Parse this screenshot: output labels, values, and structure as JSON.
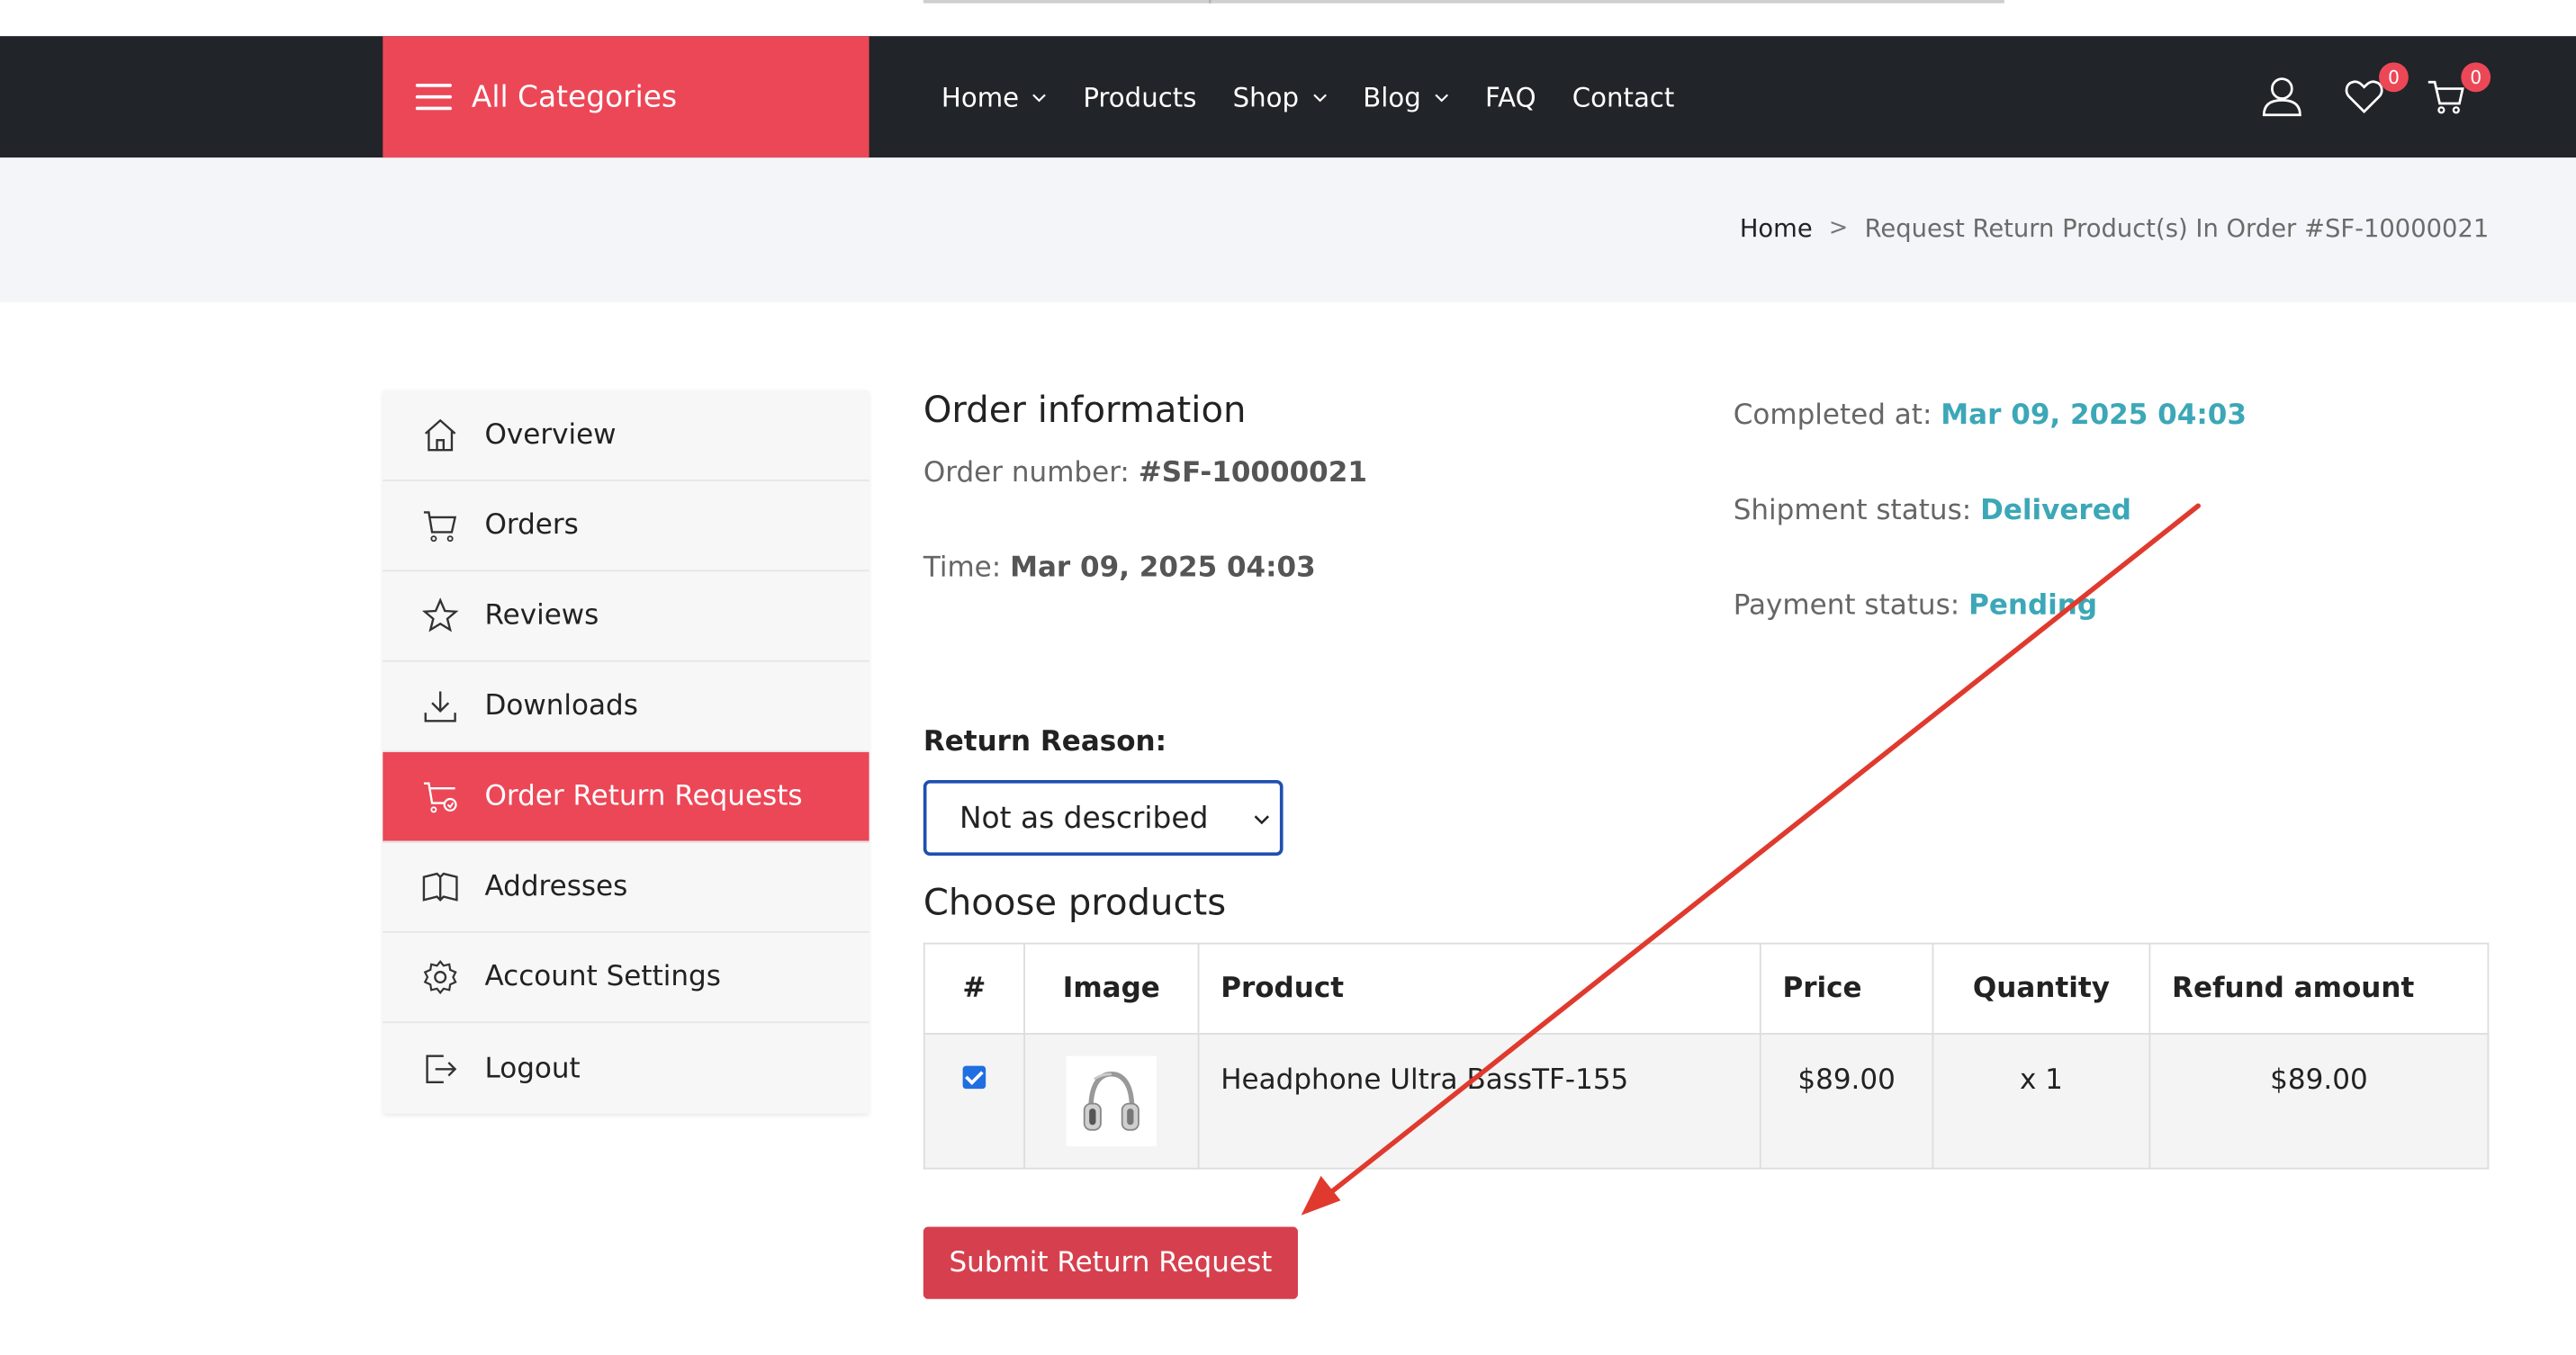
{
  "nav": {
    "all_categories": "All Categories",
    "menu": [
      {
        "label": "Home",
        "has_dropdown": true
      },
      {
        "label": "Products",
        "has_dropdown": false
      },
      {
        "label": "Shop",
        "has_dropdown": true
      },
      {
        "label": "Blog",
        "has_dropdown": true
      },
      {
        "label": "FAQ",
        "has_dropdown": false
      },
      {
        "label": "Contact",
        "has_dropdown": false
      }
    ],
    "wishlist_count": "0",
    "cart_count": "0"
  },
  "breadcrumb": {
    "home": "Home",
    "separator": ">",
    "current": "Request Return Product(s) In Order #SF-10000021"
  },
  "sidebar": {
    "items": [
      {
        "label": "Overview",
        "icon": "home-icon"
      },
      {
        "label": "Orders",
        "icon": "cart-icon"
      },
      {
        "label": "Reviews",
        "icon": "star-icon"
      },
      {
        "label": "Downloads",
        "icon": "download-icon"
      },
      {
        "label": "Order Return Requests",
        "icon": "cart-return-icon",
        "active": true
      },
      {
        "label": "Addresses",
        "icon": "book-icon"
      },
      {
        "label": "Account Settings",
        "icon": "gear-icon"
      },
      {
        "label": "Logout",
        "icon": "logout-icon"
      }
    ]
  },
  "order": {
    "title": "Order information",
    "number_label": "Order number:",
    "number_value": "#SF-10000021",
    "time_label": "Time:",
    "time_value": "Mar 09, 2025 04:03",
    "completed_label": "Completed at:",
    "completed_value": "Mar 09, 2025 04:03",
    "shipment_label": "Shipment status:",
    "shipment_value": "Delivered",
    "payment_label": "Payment status:",
    "payment_value": "Pending"
  },
  "return_form": {
    "reason_label": "Return Reason:",
    "reason_selected": "Not as described",
    "choose_title": "Choose products",
    "columns": [
      "#",
      "Image",
      "Product",
      "Price",
      "Quantity",
      "Refund amount"
    ],
    "rows": [
      {
        "checked": true,
        "product": "Headphone Ultra BassTF-155",
        "price": "$89.00",
        "quantity": "x 1",
        "refund": "$89.00"
      }
    ],
    "submit_label": "Submit Return Request"
  },
  "colors": {
    "accent_red": "#ec4757",
    "navbar_dark": "#212428",
    "status_teal": "#3ca7b7",
    "select_border": "#1f4fb0",
    "annotation_arrow": "#e03a2e"
  }
}
